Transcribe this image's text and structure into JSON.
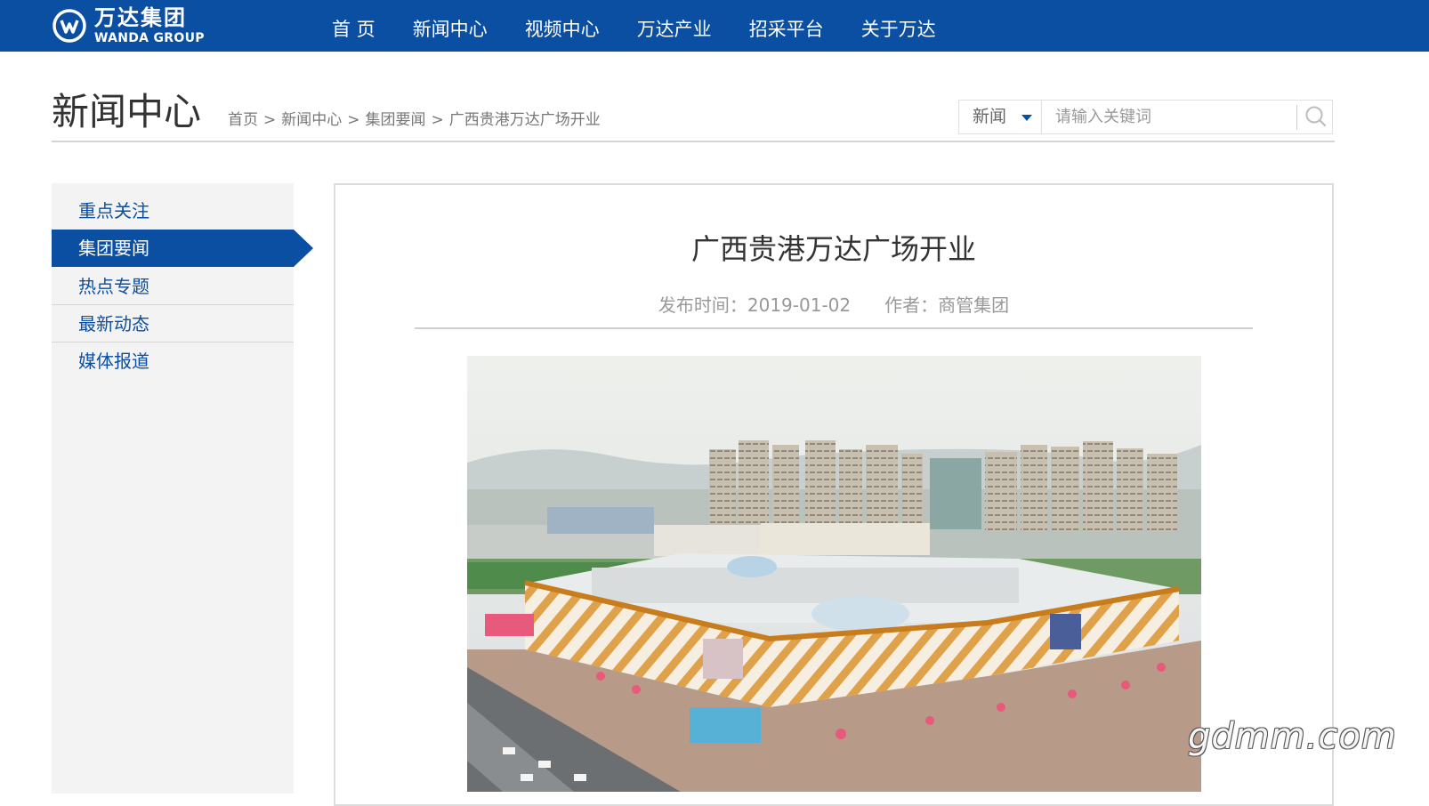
{
  "header": {
    "logo": {
      "cn": "万达集团",
      "en": "WANDA GROUP"
    },
    "nav": [
      "首 页",
      "新闻中心",
      "视频中心",
      "万达产业",
      "招采平台",
      "关于万达"
    ],
    "brand_color": "#0b4fa2"
  },
  "page": {
    "title": "新闻中心",
    "breadcrumb": [
      "首页",
      "新闻中心",
      "集团要闻",
      "广西贵港万达广场开业"
    ],
    "breadcrumb_sep": ">"
  },
  "search": {
    "category": "新闻",
    "placeholder": "请输入关键词",
    "button_icon": "search-icon"
  },
  "sidebar": {
    "items": [
      {
        "label": "重点关注",
        "active": false
      },
      {
        "label": "集团要闻",
        "active": true
      },
      {
        "label": "热点专题",
        "active": false
      },
      {
        "label": "最新动态",
        "active": false
      },
      {
        "label": "媒体报道",
        "active": false
      }
    ]
  },
  "article": {
    "title": "广西贵港万达广场开业",
    "published": "发布时间：2019-01-02",
    "author": "作者：商管集团",
    "image": "aerial-photo-of-wanda-plaza"
  },
  "watermark": "gdmm.com"
}
